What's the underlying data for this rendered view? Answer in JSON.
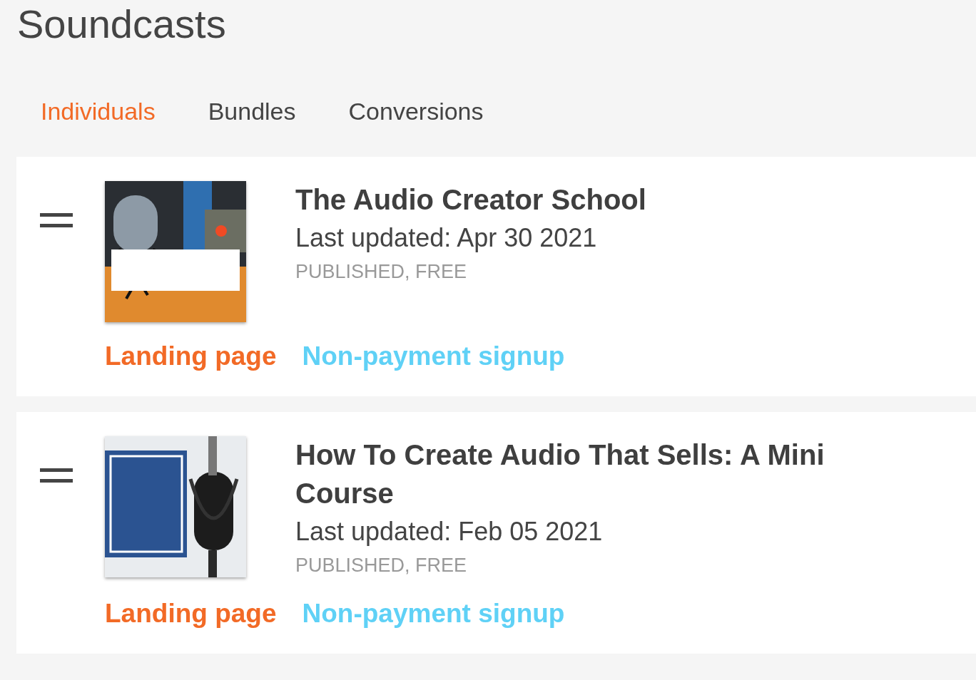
{
  "page_title": "Soundcasts",
  "tabs": [
    {
      "label": "Individuals",
      "selected": true
    },
    {
      "label": "Bundles",
      "selected": false
    },
    {
      "label": "Conversions",
      "selected": false
    }
  ],
  "soundcasts": [
    {
      "cover": {
        "kind": "picture"
      },
      "title": "The Audio Creator School",
      "updated": "Last updated: Apr 30 2021",
      "status": "PUBLISHED, FREE",
      "links": [
        {
          "label": "Landing page",
          "kind": "landing"
        },
        {
          "label": "Non-payment signup",
          "kind": "signup"
        }
      ]
    },
    {
      "cover": {
        "kind": "picture"
      },
      "title": "How To Create Audio That Sells: A Mini Course",
      "updated": "Last updated: Feb 05 2021",
      "status": "PUBLISHED, FREE",
      "links": [
        {
          "label": "Landing page",
          "kind": "landing"
        },
        {
          "label": "Non-payment signup",
          "kind": "signup"
        }
      ]
    }
  ]
}
